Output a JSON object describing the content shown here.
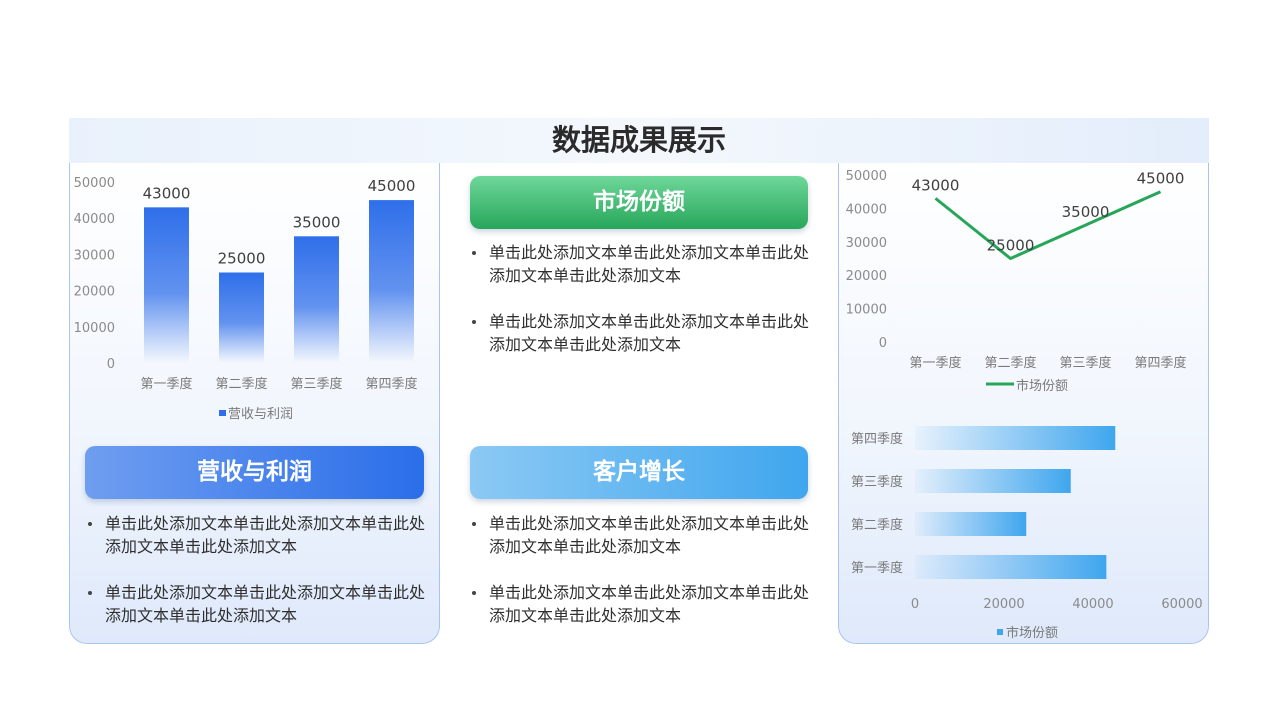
{
  "page": {
    "title": "数据成果展示"
  },
  "cards": {
    "revenue": {
      "label": "营收与利润",
      "bullets": [
        "单击此处添加文本单击此处添加文本单击此处添加文本单击此处添加文本",
        "单击此处添加文本单击此处添加文本单击此处添加文本单击此处添加文本"
      ]
    },
    "market_share": {
      "label": "市场份额",
      "bullets": [
        "单击此处添加文本单击此处添加文本单击此处添加文本单击此处添加文本",
        "单击此处添加文本单击此处添加文本单击此处添加文本单击此处添加文本"
      ]
    },
    "customer_growth": {
      "label": "客户增长",
      "bullets": [
        "单击此处添加文本单击此处添加文本单击此处添加文本单击此处添加文本",
        "单击此处添加文本单击此处添加文本单击此处添加文本单击此处添加文本"
      ]
    }
  },
  "chart_data": [
    {
      "type": "bar",
      "categories": [
        "第一季度",
        "第二季度",
        "第三季度",
        "第四季度"
      ],
      "series": [
        {
          "name": "营收与利润",
          "values": [
            43000,
            25000,
            35000,
            45000
          ]
        }
      ],
      "ylim": [
        0,
        50000
      ],
      "yticks": [
        0,
        10000,
        20000,
        30000,
        40000,
        50000
      ],
      "data_labels": true,
      "legend": "bottom",
      "color": "#2f6fea"
    },
    {
      "type": "line",
      "categories": [
        "第一季度",
        "第二季度",
        "第三季度",
        "第四季度"
      ],
      "series": [
        {
          "name": "市场份额",
          "values": [
            43000,
            25000,
            35000,
            45000
          ]
        }
      ],
      "ylim": [
        0,
        50000
      ],
      "yticks": [
        0,
        10000,
        20000,
        30000,
        40000,
        50000
      ],
      "data_labels": true,
      "legend": "bottom",
      "color": "#27a65a"
    },
    {
      "type": "bar",
      "orientation": "horizontal",
      "categories": [
        "第一季度",
        "第二季度",
        "第三季度",
        "第四季度"
      ],
      "series": [
        {
          "name": "市场份额",
          "values": [
            43000,
            25000,
            35000,
            45000
          ]
        }
      ],
      "xlim": [
        0,
        60000
      ],
      "xticks": [
        0,
        20000,
        40000,
        60000
      ],
      "legend": "bottom",
      "color": "#3fa6ee"
    }
  ]
}
